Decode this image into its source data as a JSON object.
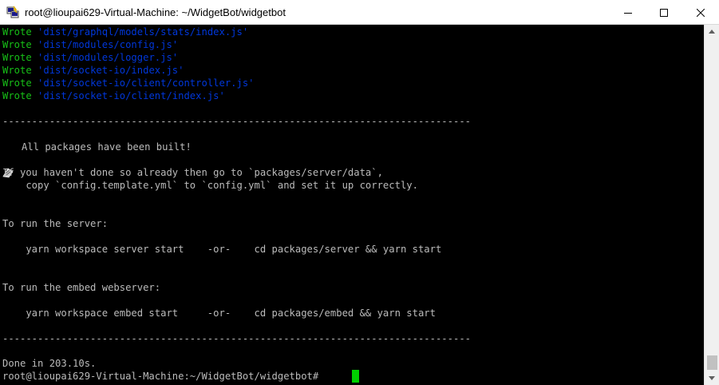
{
  "window": {
    "title": "root@lioupai629-Virtual-Machine: ~/WidgetBot/widgetbot",
    "app_icon": "putty-terminal-icon",
    "controls": {
      "minimize": "minimize-icon",
      "maximize": "maximize-icon",
      "close": "close-icon"
    }
  },
  "terminal": {
    "wrote_lines": [
      {
        "verb": "Wrote",
        "path": "'dist/graphql/models/stats/index.js'"
      },
      {
        "verb": "Wrote",
        "path": "'dist/modules/config.js'"
      },
      {
        "verb": "Wrote",
        "path": "'dist/modules/logger.js'"
      },
      {
        "verb": "Wrote",
        "path": "'dist/socket-io/index.js'"
      },
      {
        "verb": "Wrote",
        "path": "'dist/socket-io/client/controller.js'"
      },
      {
        "verb": "Wrote",
        "path": "'dist/socket-io/client/index.js'"
      }
    ],
    "separator": "--------------------------------------------------------------------------------",
    "built_message": "All packages have been built!",
    "built_icon": "package-icon",
    "config_line1": "If you haven't done so already then go to `packages/server/data`,",
    "config_line2": "    copy `config.template.yml` to `config.yml` and set it up correctly.",
    "run_server_heading": "To run the server:",
    "run_server_cmd": "    yarn workspace server start    -or-    cd packages/server && yarn start",
    "run_embed_heading": "To run the embed webserver:",
    "run_embed_cmd": "    yarn workspace embed start     -or-    cd packages/embed && yarn start",
    "done": "Done in 203.10s.",
    "prompt": "root@lioupai629-Virtual-Machine:~/WidgetBot/widgetbot#"
  },
  "colors": {
    "background": "#000000",
    "text": "#bbbbbb",
    "wrote": "#17c017",
    "path": "#0037da",
    "cursor": "#00d000"
  }
}
